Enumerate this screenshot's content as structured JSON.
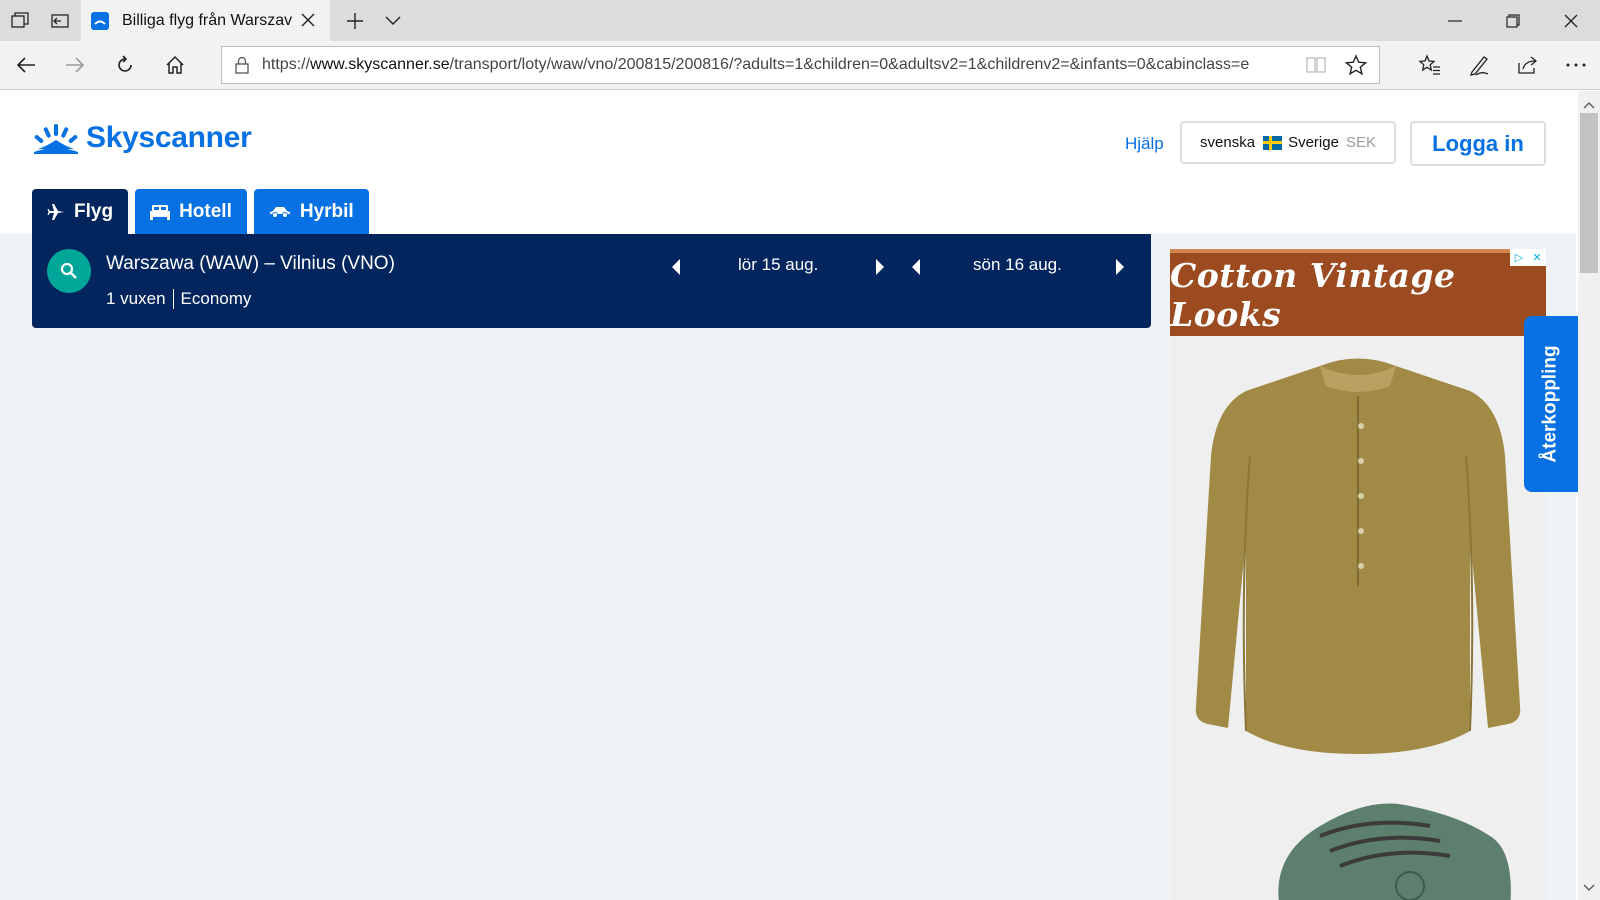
{
  "browser": {
    "tab_title": "Billiga flyg från Warszav",
    "url_prefix": "https://",
    "url_domain": "www.skyscanner.se",
    "url_path": "/transport/loty/waw/vno/200815/200816/?adults=1&children=0&adultsv2=1&childrenv2=&infants=0&cabinclass=e",
    "icons": [
      "tab-list-icon",
      "set-tabs-aside-icon",
      "new-tab-icon",
      "tab-dropdown-icon",
      "minimize-icon",
      "restore-icon",
      "close-icon",
      "back-icon",
      "forward-icon",
      "refresh-icon",
      "home-icon",
      "lock-icon",
      "reading-view-icon",
      "favorite-star-icon",
      "favorites-icon",
      "pen-icon",
      "share-icon",
      "more-icon"
    ]
  },
  "header": {
    "logo_text": "Skyscanner",
    "help": "Hjälp",
    "locale_language": "svenska",
    "locale_country": "Sverige",
    "locale_currency": "SEK",
    "login": "Logga in"
  },
  "tabs": [
    {
      "label": "Flyg",
      "icon": "plane-icon",
      "active": true
    },
    {
      "label": "Hotell",
      "icon": "bed-icon",
      "active": false
    },
    {
      "label": "Hyrbil",
      "icon": "car-icon",
      "active": false
    }
  ],
  "search": {
    "route": "Warszawa (WAW) – Vilnius (VNO)",
    "travellers": "1 vuxen",
    "cabin": "Economy",
    "outbound_date": "lör 15 aug.",
    "return_date": "sön 16 aug."
  },
  "ad": {
    "headline": "Cotton Vintage Looks"
  },
  "feedback": "Återkoppling",
  "colors": {
    "brand_blue": "#0770e3",
    "navy": "#02255d",
    "teal": "#00a698",
    "page_bg": "#eff3f8",
    "ad_brown": "#9c4a1f"
  }
}
